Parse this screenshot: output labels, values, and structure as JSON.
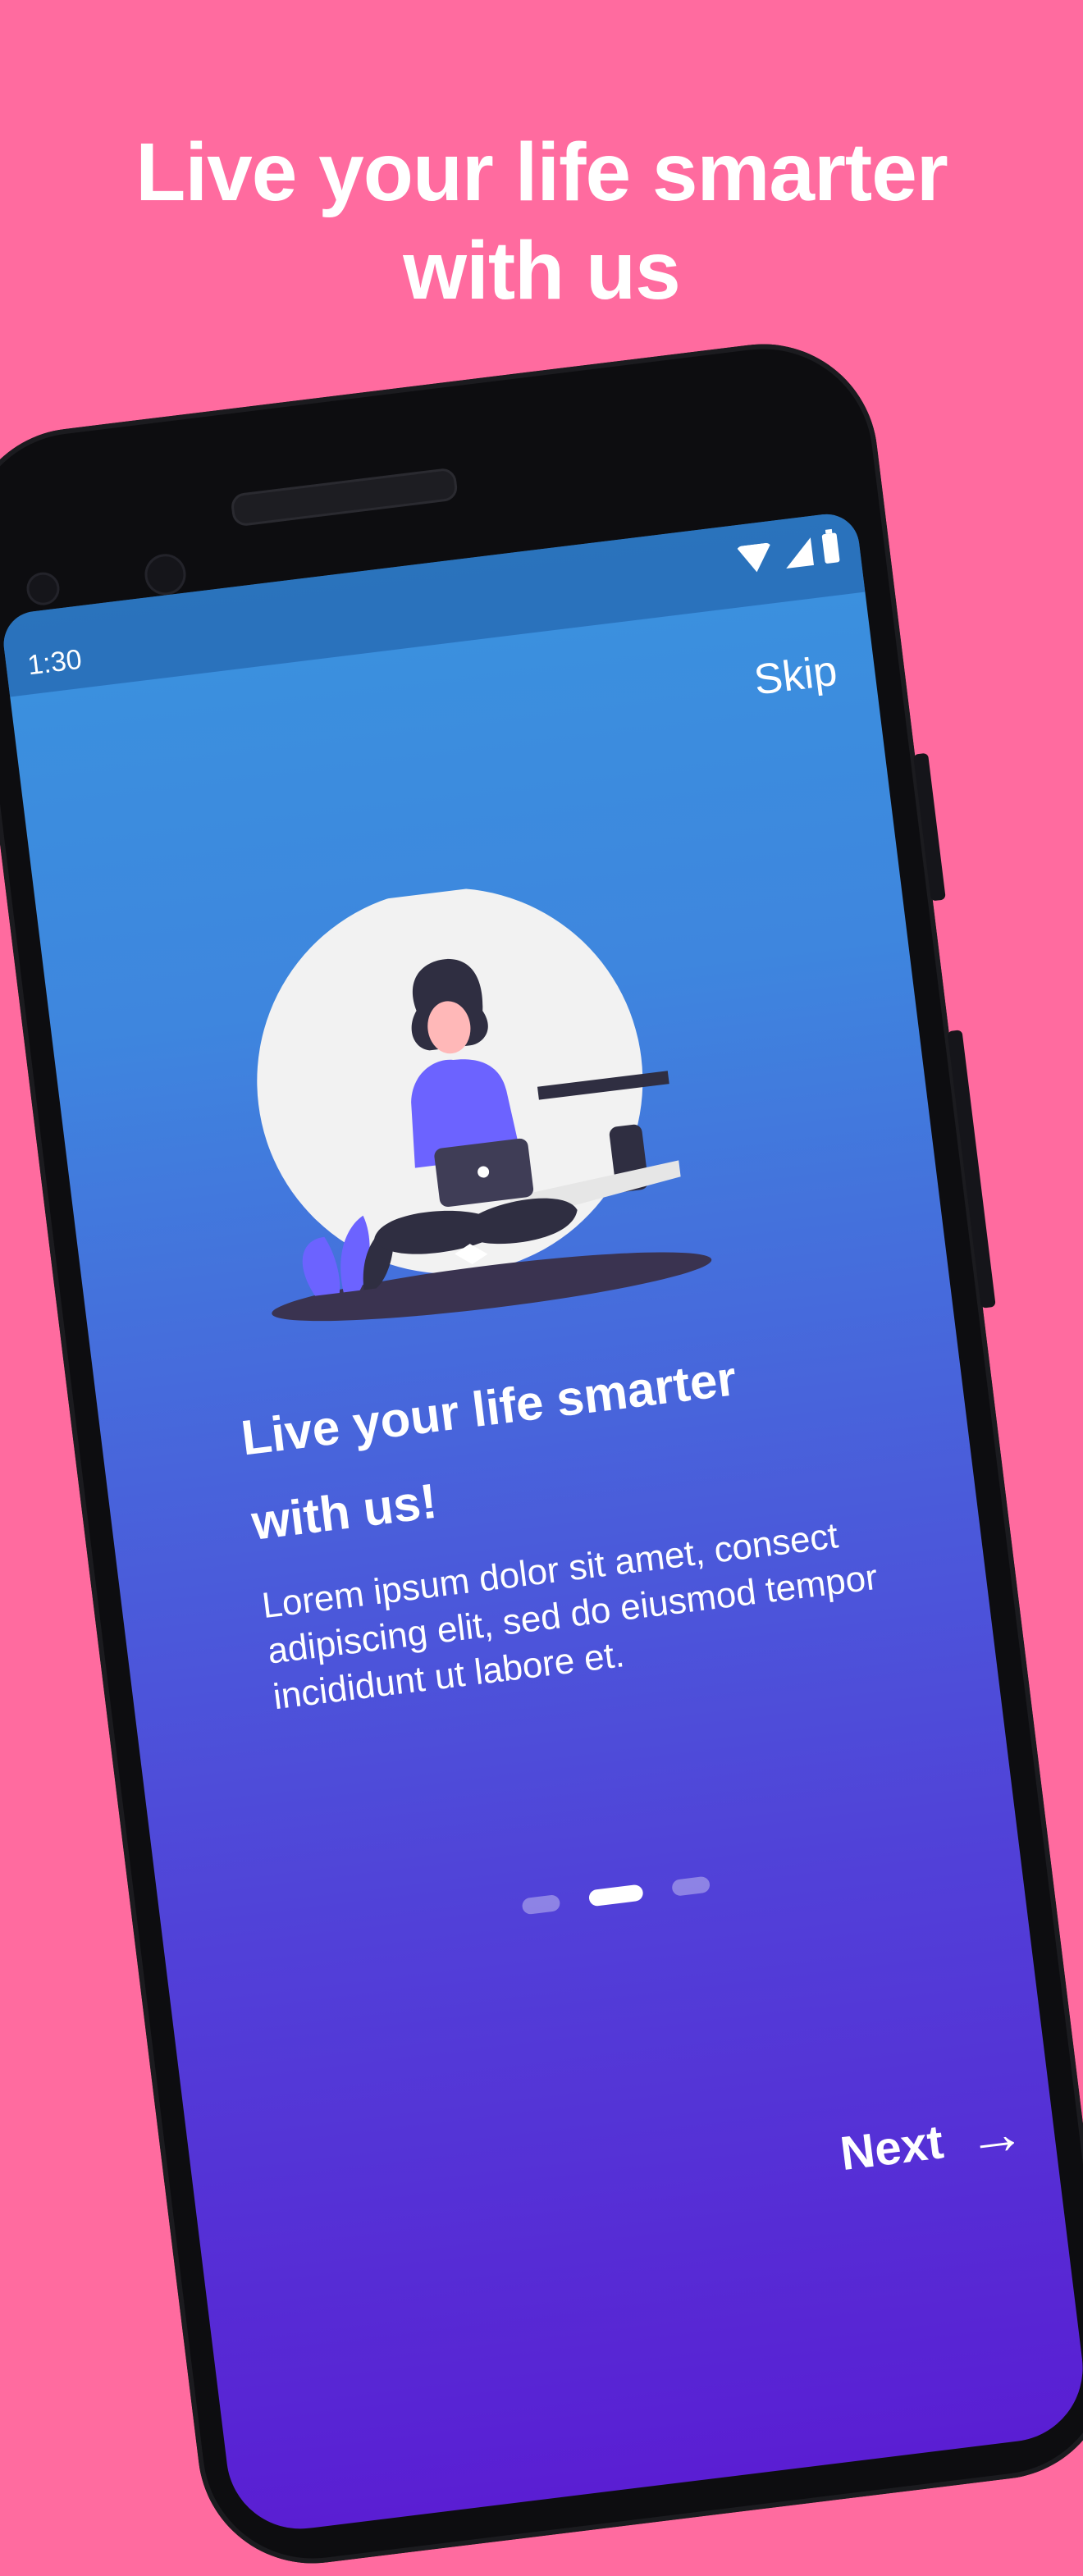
{
  "marketing": {
    "headline_line1": "Live your life smarter",
    "headline_line2": "with us"
  },
  "status_bar": {
    "time": "1:30",
    "icons": [
      "wifi-icon",
      "signal-icon",
      "battery-icon"
    ]
  },
  "onboarding": {
    "skip_label": "Skip",
    "title_line1": "Live your life smarter",
    "title_line2": "with us!",
    "body": "Lorem ipsum dolor sit amet, consect adipiscing elit, sed do eiusmod tempor incididunt ut labore et.",
    "page_indicator": {
      "total": 3,
      "active_index": 1
    },
    "next_label": "Next",
    "next_icon": "arrow-right-icon"
  },
  "colors": {
    "background": "#ff6b9f",
    "gradient_top": "#3a92de",
    "gradient_bottom": "#5a1ed3",
    "text": "#ffffff"
  }
}
